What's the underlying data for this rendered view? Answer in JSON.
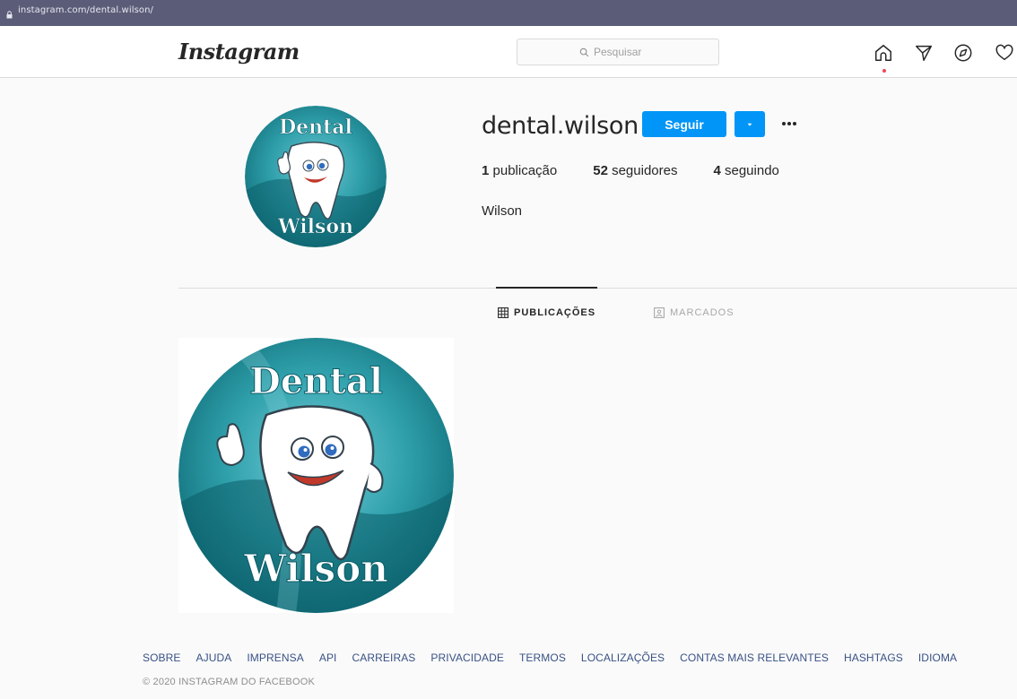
{
  "browser": {
    "url": "instagram.com/dental.wilson/"
  },
  "header": {
    "logo": "Instagram",
    "search_placeholder": "Pesquisar",
    "nav_icons": [
      "home-icon",
      "direct-icon",
      "explore-icon",
      "heart-icon"
    ]
  },
  "profile": {
    "username": "dental.wilson",
    "follow_label": "Seguir",
    "stats": [
      {
        "count": "1",
        "label": "publicação"
      },
      {
        "count": "52",
        "label": "seguidores"
      },
      {
        "count": "4",
        "label": "seguindo"
      }
    ],
    "full_name": "Wilson",
    "avatar_text": {
      "top": "Dental",
      "bottom": "Wilson"
    }
  },
  "tabs": [
    {
      "label": "PUBLICAÇÕES",
      "active": true
    },
    {
      "label": "MARCADOS",
      "active": false
    }
  ],
  "posts": [
    {
      "text_top": "Dental",
      "text_bottom": "Wilson"
    }
  ],
  "footer": {
    "links": [
      "SOBRE",
      "AJUDA",
      "IMPRENSA",
      "API",
      "CARREIRAS",
      "PRIVACIDADE",
      "TERMOS",
      "LOCALIZAÇÕES",
      "CONTAS MAIS RELEVANTES",
      "HASHTAGS",
      "IDIOMA"
    ],
    "copyright": "© 2020 INSTAGRAM DO FACEBOOK"
  },
  "colors": {
    "primary_button": "#0095f6",
    "teal_dark": "#0f6d78",
    "teal_light": "#3fb3c0",
    "link": "#385185",
    "notification_dot": "#ed4956"
  }
}
